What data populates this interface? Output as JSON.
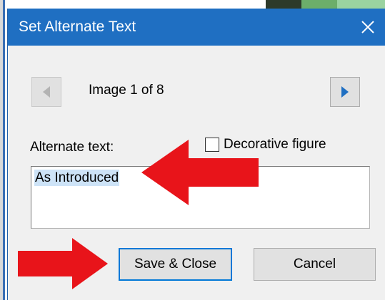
{
  "dialog": {
    "title": "Set Alternate Text",
    "close_icon": "close-icon",
    "prev_icon": "triangle-left-icon",
    "next_icon": "triangle-right-icon",
    "image_counter": "Image 1 of 8",
    "alt_text_label": "Alternate text:",
    "decorative_label": "Decorative figure",
    "decorative_checked": false,
    "alt_text_value": "As Introduced",
    "save_label": "Save & Close",
    "cancel_label": "Cancel"
  },
  "colors": {
    "titlebar": "#1f6fc2",
    "dialog_bg": "#f0f0f0",
    "selection": "#cde3f7",
    "accent_border": "#0078d7",
    "annotation_arrow": "#e8141a"
  },
  "annotations": {
    "arrow_icon": "red-arrow-icon"
  }
}
